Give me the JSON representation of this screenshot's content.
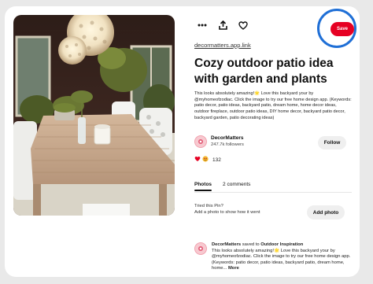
{
  "toolbar": {
    "save_label": "Save"
  },
  "pin": {
    "link": "decormatters.app.link",
    "title": "Cozy outdoor patio idea with garden and plants",
    "description": "This looks absolutely amazing!🌟 Love this backyard your by @myhomeofzodiac. Click the image to try our free home design app. (Keywords: patio decor, patio ideas, backyard patio, dream home, home decor ideas, outdoor fireplace, outdoor patio ideas, DIY home decor, backyard patio decor, backyard garden, patio decorating ideas)"
  },
  "author": {
    "name": "DecorMatters",
    "followers": "247.7k followers",
    "follow_label": "Follow"
  },
  "reactions": {
    "count": "132"
  },
  "tabs": [
    {
      "label": "Photos"
    },
    {
      "label": "2 comments"
    }
  ],
  "tried": {
    "title": "Tried this Pin?",
    "subtitle": "Add a photo to show how it went",
    "button_label": "Add photo"
  },
  "comment": {
    "author": "DecorMatters",
    "saved_text": "saved to",
    "board": "Outdoor Inspiration",
    "text": "This looks absolutely amazing!🌟 Love this backyard your by @myhomeofzodiac. Click the image to try our free home design app. (Keywords: patio decor, patio ideas, backyard patio, dream home, home...",
    "more_label": "More"
  },
  "colors": {
    "save": "#e60023",
    "ring": "#1f6fd6",
    "button_bg": "#efefef"
  },
  "icons": [
    "more-icon",
    "share-icon",
    "heart-icon",
    "heart-reaction-icon",
    "star-eyes-reaction-icon"
  ]
}
